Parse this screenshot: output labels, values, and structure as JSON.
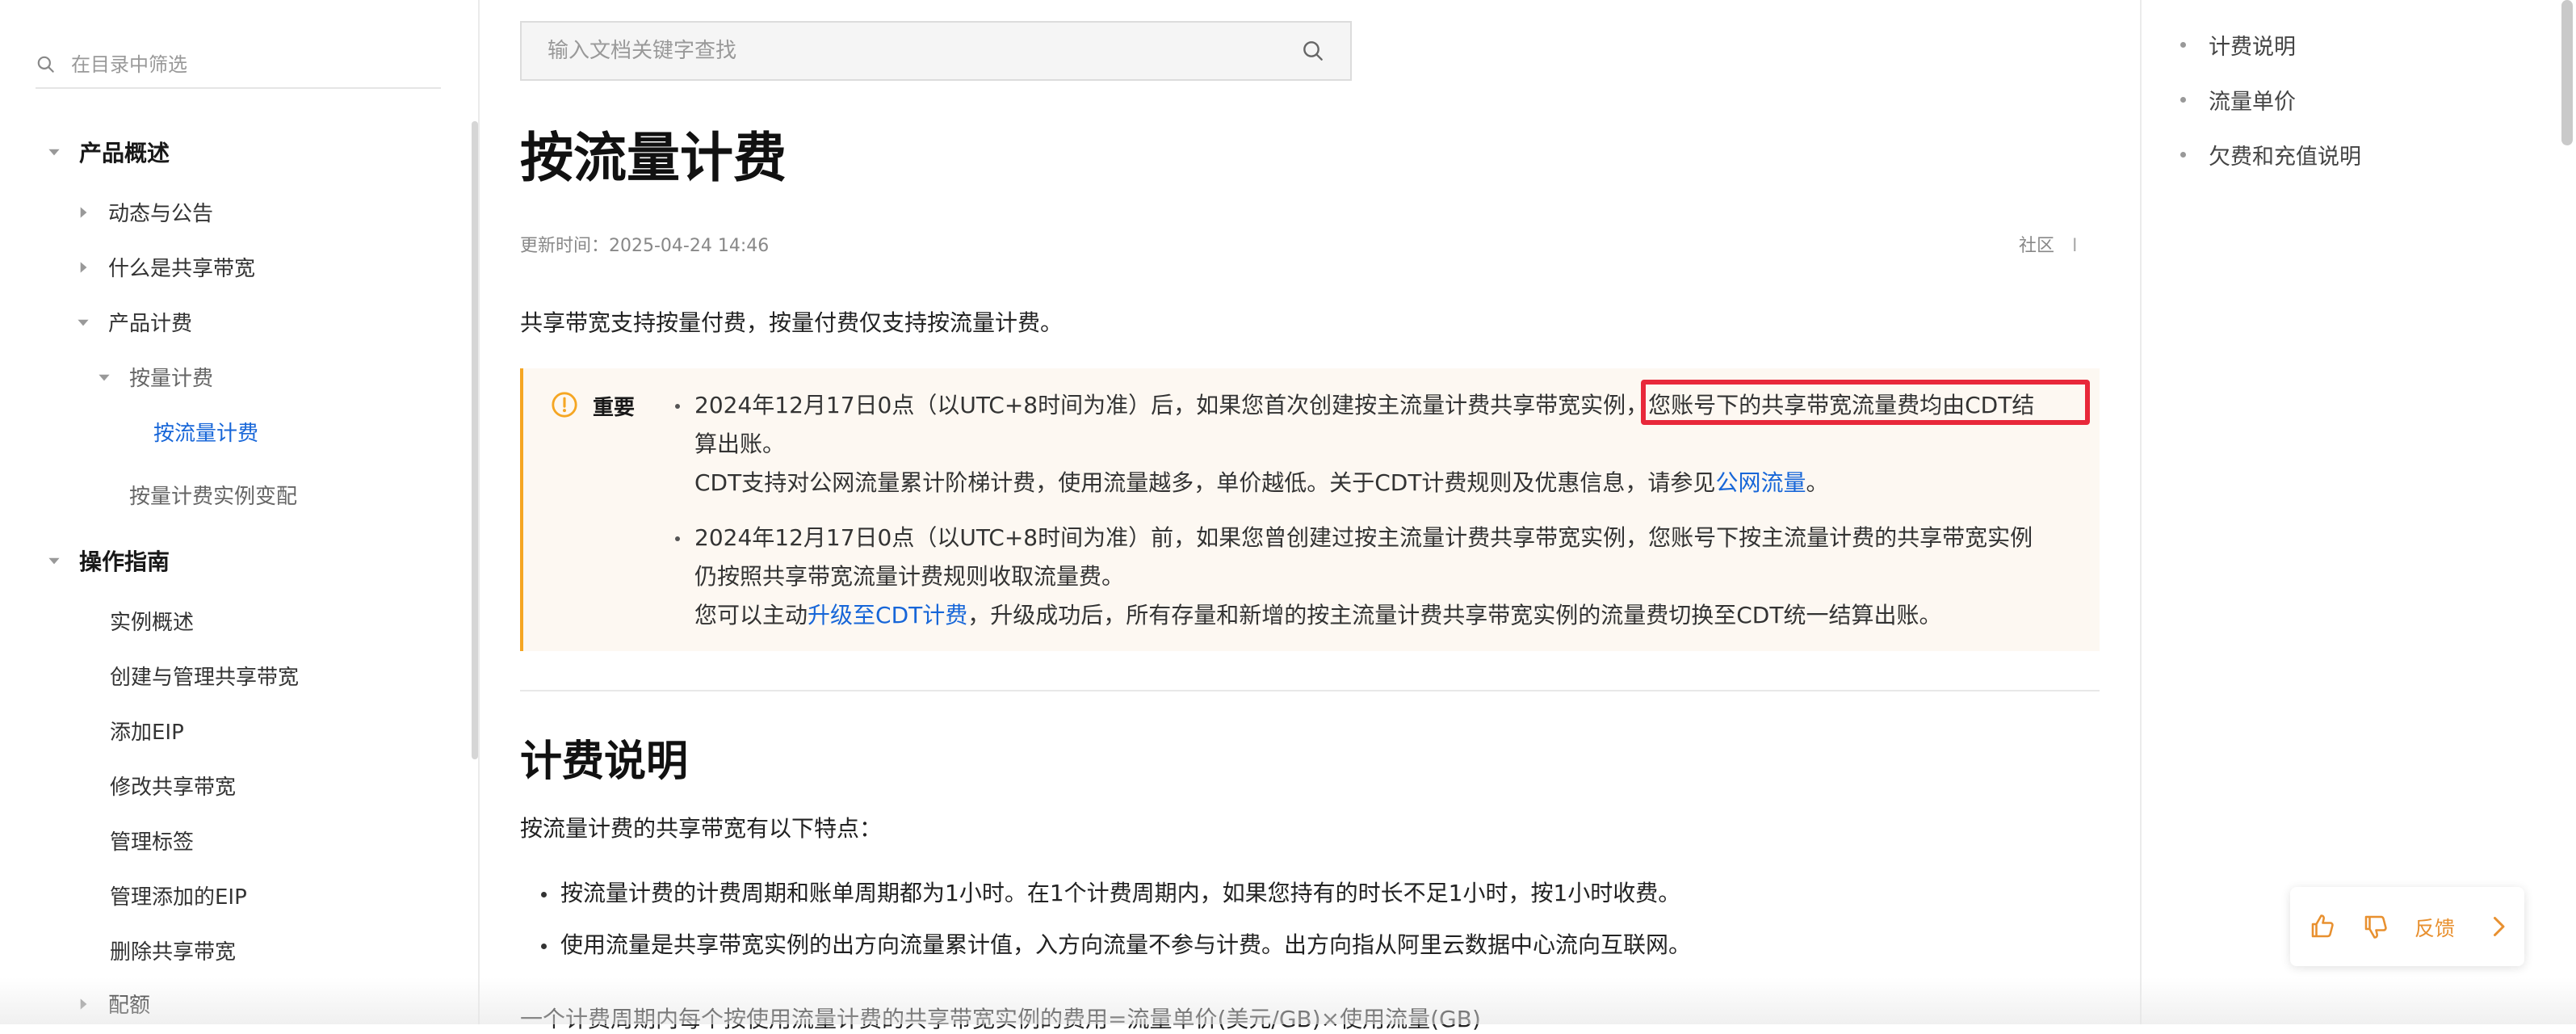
{
  "sidebar": {
    "filter_placeholder": "在目录中筛选",
    "items": [
      {
        "label": "产品概述"
      },
      {
        "label": "动态与公告"
      },
      {
        "label": "什么是共享带宽"
      },
      {
        "label": "产品计费"
      },
      {
        "label": "按量计费"
      },
      {
        "label": "按流量计费"
      },
      {
        "label": "按量计费实例变配"
      },
      {
        "label": "操作指南"
      },
      {
        "label": "实例概述"
      },
      {
        "label": "创建与管理共享带宽"
      },
      {
        "label": "添加EIP"
      },
      {
        "label": "修改共享带宽"
      },
      {
        "label": "管理标签"
      },
      {
        "label": "管理添加的EIP"
      },
      {
        "label": "删除共享带宽"
      },
      {
        "label": "配额"
      }
    ]
  },
  "search": {
    "placeholder": "输入文档关键字查找"
  },
  "article": {
    "title": "按流量计费",
    "updated": "更新时间：2025-04-24 14:46",
    "community": "社区",
    "community_sep": "I",
    "intro": "共享带宽支持按量付费，按量付费仅支持按流量计费。",
    "notice": {
      "label": "重要",
      "b1_line1_a": "2024年12月17日0点（以UTC+8时间为准）后，如果您首次创建按主流量计费共享带宽实例，",
      "b1_line1_b": "您账号下的共享带宽流量费均由CDT结",
      "b1_line2": "算出账。",
      "b1_line3_a": "CDT支持对公网流量累计阶梯计费，使用流量越多，单价越低。关于CDT计费规则及优惠信息，请参见",
      "b1_line3_link": "公网流量",
      "b1_line3_end": "。",
      "b2_line1": "2024年12月17日0点（以UTC+8时间为准）前，如果您曾创建过按主流量计费共享带宽实例，您账号下按主流量计费的共享带宽实例",
      "b2_line2": "仍按照共享带宽流量计费规则收取流量费。",
      "b2_line3_a": "您可以主动",
      "b2_line3_link": "升级至CDT计费",
      "b2_line3_b": "，升级成功后，所有存量和新增的按主流量计费共享带宽实例的流量费切换至CDT统一结算出账。"
    },
    "section_title": "计费说明",
    "section_intro": "按流量计费的共享带宽有以下特点：",
    "features": [
      "按流量计费的计费周期和账单周期都为1小时。在1个计费周期内，如果您持有的时长不足1小时，按1小时收费。",
      "使用流量是共享带宽实例的出方向流量累计值，入方向流量不参与计费。出方向指从阿里云数据中心流向互联网。"
    ],
    "formula": "一个计费周期内每个按使用流量计费的共享带宽实例的费用=流量单价(美元/GB)×使用流量(GB)"
  },
  "toc": {
    "items": [
      "计费说明",
      "流量单价",
      "欠费和充值说明"
    ]
  },
  "feedback": {
    "label": "反馈"
  },
  "colors": {
    "accent_link": "#1766d8",
    "warning": "#f5a623",
    "highlight": "#e8283a",
    "feedback": "#e8902f"
  }
}
